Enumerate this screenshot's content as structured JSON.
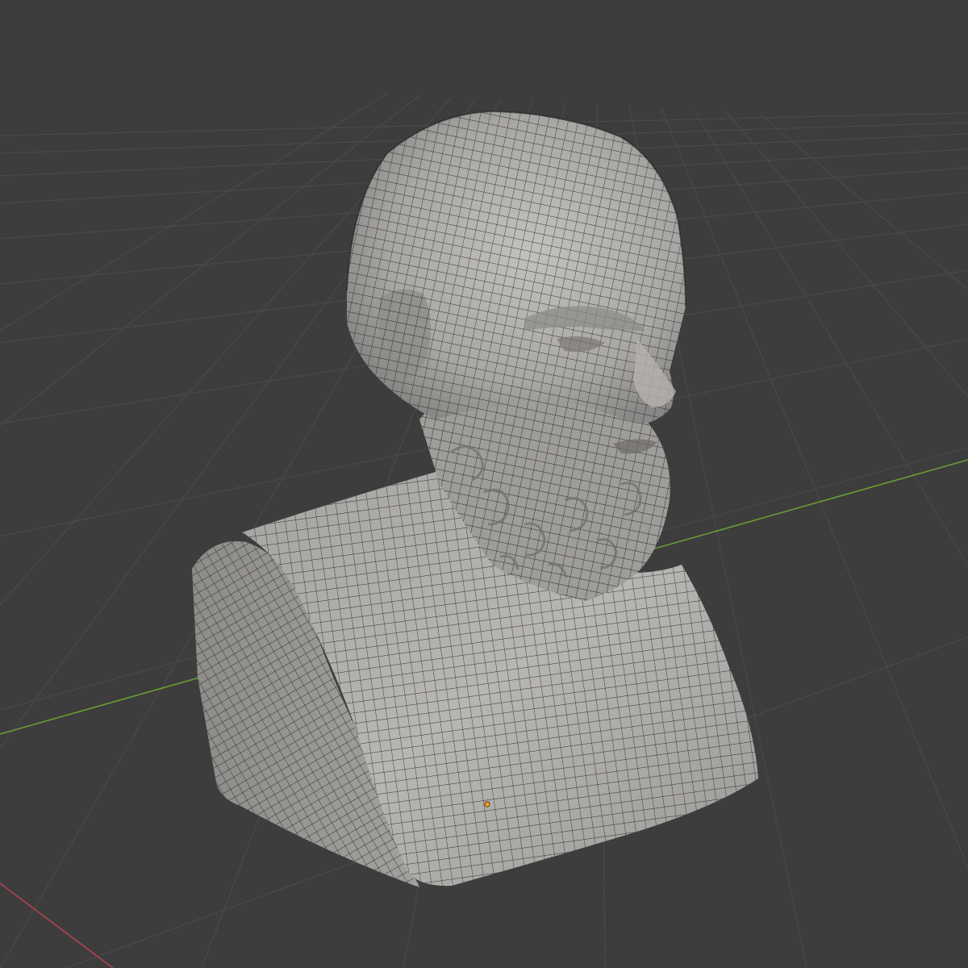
{
  "viewport": {
    "mode": "3d-viewport",
    "shading": "solid",
    "overlay": "wireframe",
    "projection": "perspective"
  },
  "colors": {
    "background": "#3d3d3d",
    "grid_line": "#4a4a4a",
    "axis_x": "#b7404e",
    "axis_y": "#6b9a34",
    "mesh_fill": "#a8a6a3",
    "mesh_shadow": "#7c7a78",
    "mesh_highlight": "#c9c7c4",
    "wireframe": "#1c1c1c",
    "origin_point": "#ff9a1e"
  },
  "scene": {
    "object": "bust-mesh",
    "origin_visible": true,
    "grid_visible": true
  }
}
